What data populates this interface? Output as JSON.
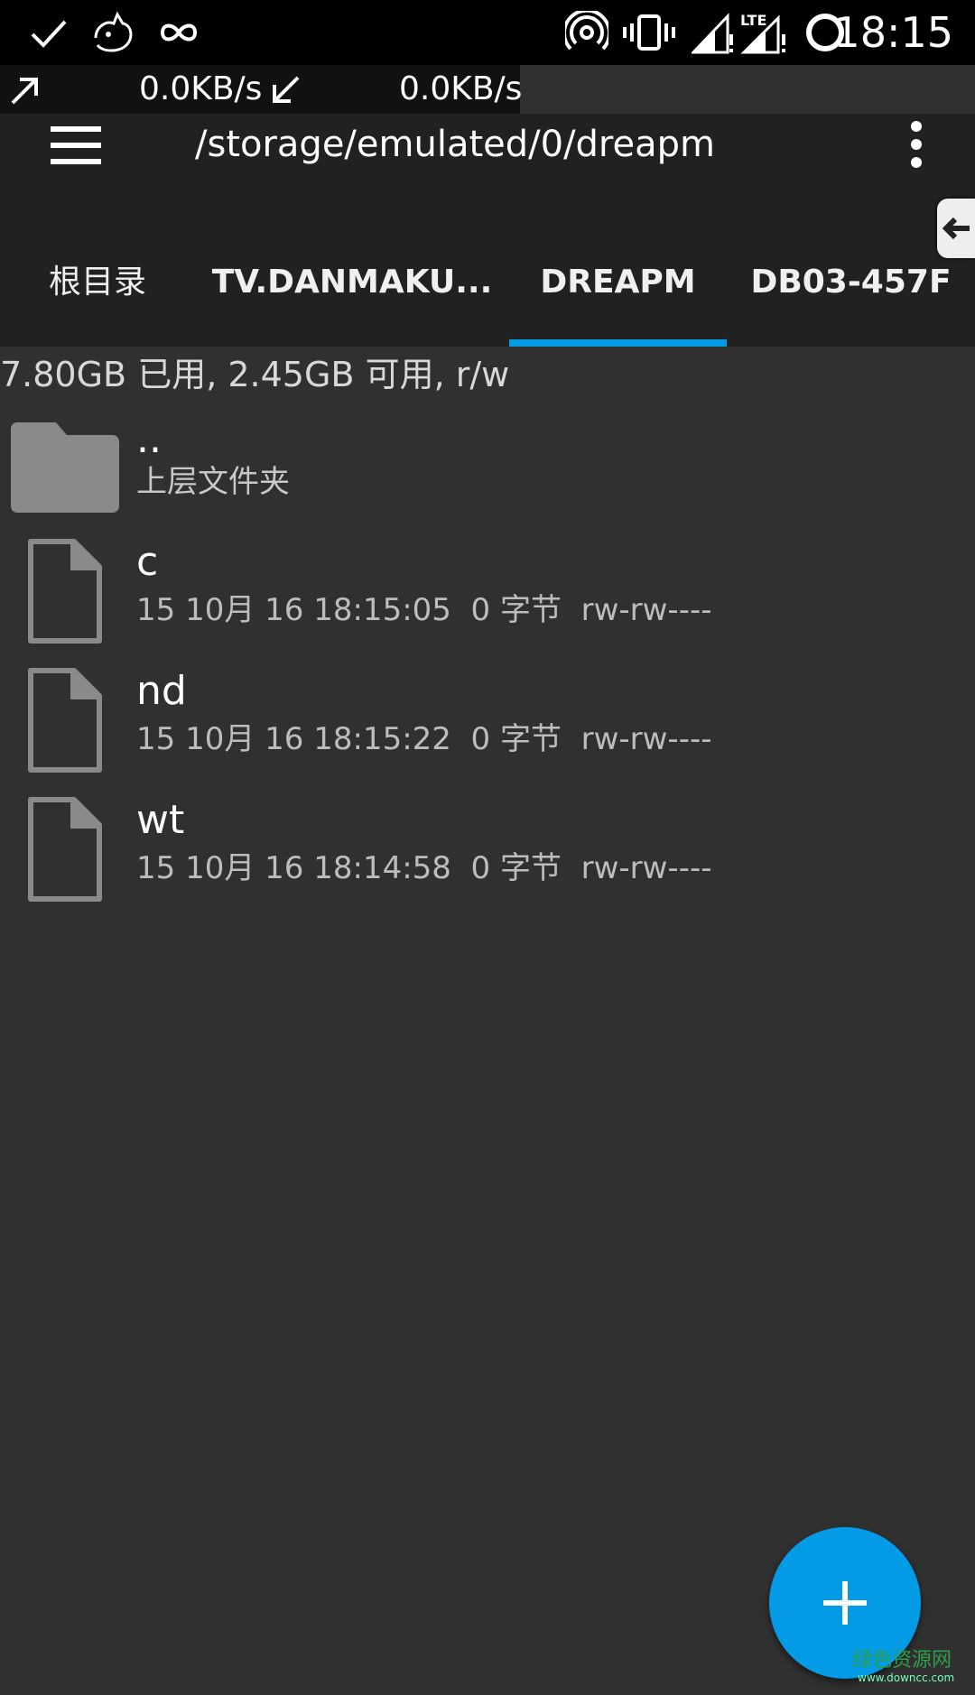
{
  "status_bar": {
    "time": "18:15",
    "network_type": "LTE",
    "icons": [
      "check-icon",
      "cat-icon",
      "infinity-icon",
      "hotspot-icon",
      "vibrate-icon",
      "signal-icon",
      "signal-lte-icon",
      "battery-ring-icon"
    ]
  },
  "net_speed": {
    "upload": "0.0KB/s",
    "download": "0.0KB/s"
  },
  "app_bar": {
    "path": "/storage/emulated/0/dreapm"
  },
  "tabs": [
    {
      "label": "根目录",
      "selected": false
    },
    {
      "label": "TV.DANMAKU...",
      "selected": false
    },
    {
      "label": "DREAPM",
      "selected": true
    },
    {
      "label": "DB03-457F",
      "selected": false
    }
  ],
  "storage_info": "7.80GB 已用, 2.45GB 可用, r/w",
  "parent_folder": {
    "name": "..",
    "label": "上层文件夹"
  },
  "files": [
    {
      "name": "c",
      "meta": "15 10月 16 18:15:05  0 字节  rw-rw----"
    },
    {
      "name": "nd",
      "meta": "15 10月 16 18:15:22  0 字节  rw-rw----"
    },
    {
      "name": "wt",
      "meta": "15 10月 16 18:14:58  0 字节  rw-rw----"
    }
  ],
  "colors": {
    "accent": "#039be5",
    "background": "#303030",
    "toolbar": "#212121"
  },
  "watermark": {
    "text": "绿色资源网",
    "url": "www.downcc.com"
  }
}
